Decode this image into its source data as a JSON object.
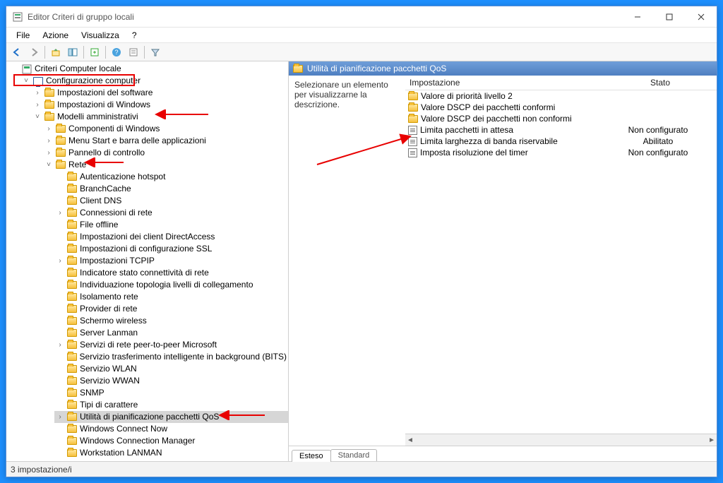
{
  "window": {
    "title": "Editor Criteri di gruppo locali"
  },
  "menu": {
    "file": "File",
    "action": "Azione",
    "view": "Visualizza",
    "help": "?"
  },
  "tree": {
    "root": "Criteri Computer locale",
    "computer_config": "Configurazione computer",
    "software_settings": "Impostazioni del software",
    "windows_settings": "Impostazioni di Windows",
    "admin_templates": "Modelli amministrativi",
    "windows_components": "Componenti di Windows",
    "start_taskbar": "Menu Start e barra delle applicazioni",
    "control_panel": "Pannello di controllo",
    "network": "Rete",
    "net": {
      "hotspot": "Autenticazione hotspot",
      "branchcache": "BranchCache",
      "dnsclient": "Client DNS",
      "netconn": "Connessioni di rete",
      "offline": "File offline",
      "directaccess": "Impostazioni dei client DirectAccess",
      "ssl": "Impostazioni di configurazione SSL",
      "tcpip": "Impostazioni TCPIP",
      "connind": "Indicatore stato connettività di rete",
      "topology": "Individuazione topologia livelli di collegamento",
      "isolation": "Isolamento rete",
      "provider": "Provider di rete",
      "wireless": "Schermo wireless",
      "lanman": "Server Lanman",
      "p2p": "Servizi di rete peer-to-peer Microsoft",
      "bits": "Servizio trasferimento intelligente in background (BITS)",
      "wlan": "Servizio WLAN",
      "wwan": "Servizio WWAN",
      "snmp": "SNMP",
      "fonts": "Tipi di carattere",
      "qos": "Utilità di pianificazione pacchetti QoS",
      "wcn": "Windows Connect Now",
      "wcm": "Windows Connection Manager",
      "lanmanws": "Workstation LANMAN"
    }
  },
  "detail": {
    "header": "Utilità di pianificazione pacchetti QoS",
    "instruction": "Selezionare un elemento per visualizzarne la descrizione.",
    "col_setting": "Impostazione",
    "col_state": "Stato",
    "items": [
      {
        "type": "folder",
        "name": "Valore di priorità livello 2",
        "state": ""
      },
      {
        "type": "folder",
        "name": "Valore DSCP dei pacchetti conformi",
        "state": ""
      },
      {
        "type": "folder",
        "name": "Valore DSCP dei pacchetti non conformi",
        "state": ""
      },
      {
        "type": "setting",
        "name": "Limita pacchetti in attesa",
        "state": "Non configurato"
      },
      {
        "type": "setting",
        "name": "Limita larghezza di banda riservabile",
        "state": "Abilitato"
      },
      {
        "type": "setting",
        "name": "Imposta risoluzione del timer",
        "state": "Non configurato"
      }
    ],
    "tab_ext": "Esteso",
    "tab_std": "Standard"
  },
  "status": "3 impostazione/i"
}
